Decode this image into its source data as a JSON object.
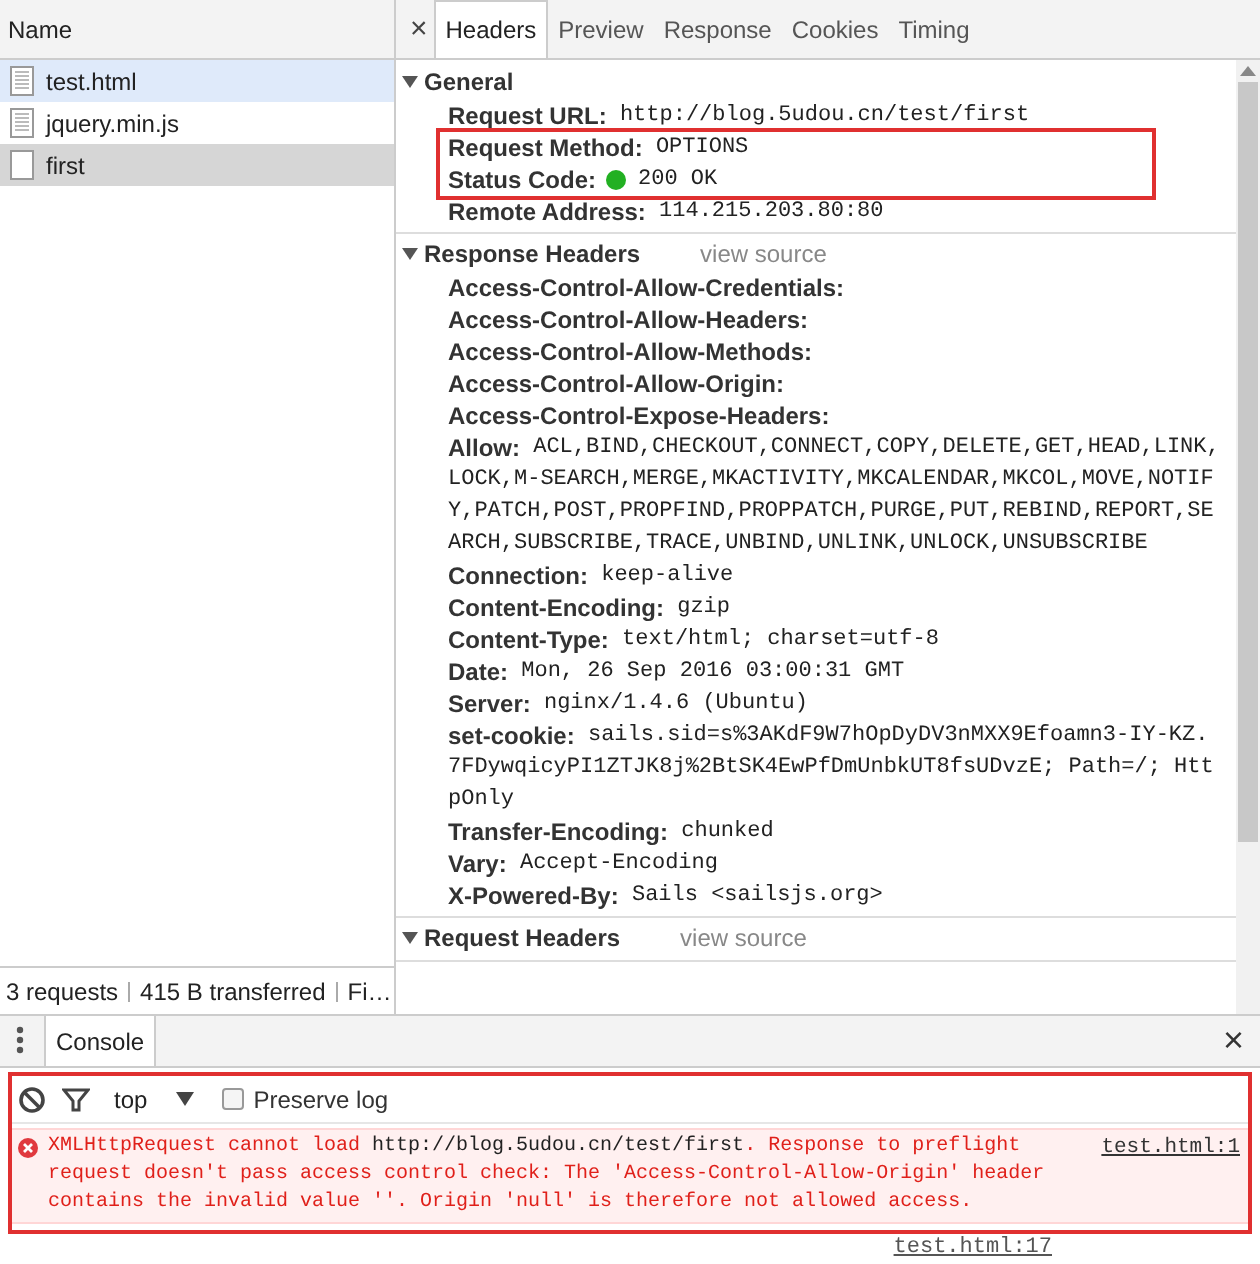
{
  "requests": {
    "column": "Name",
    "items": [
      {
        "name": "test.html",
        "kind": "document",
        "selected": false,
        "hovered": true
      },
      {
        "name": "jquery.min.js",
        "kind": "document",
        "selected": false,
        "hovered": false
      },
      {
        "name": "first",
        "kind": "blank",
        "selected": true,
        "hovered": false
      }
    ],
    "status": [
      "3 requests",
      "415 B transferred",
      "Fi…"
    ]
  },
  "details": {
    "close": "×",
    "tabs": [
      {
        "label": "Headers",
        "selected": true
      },
      {
        "label": "Preview",
        "selected": false
      },
      {
        "label": "Response",
        "selected": false
      },
      {
        "label": "Cookies",
        "selected": false
      },
      {
        "label": "Timing",
        "selected": false
      }
    ],
    "sections": [
      {
        "title": "General",
        "expanded": true,
        "headers": [
          {
            "name": "Request URL:",
            "value": "http://blog.5udou.cn/test/first",
            "highlighted": false
          },
          {
            "name": "Request Method:",
            "value": "OPTIONS",
            "highlighted": true
          },
          {
            "name": "Status Code:",
            "value": "200 OK",
            "kind": "status",
            "highlighted": true
          },
          {
            "name": "Remote Address:",
            "value": "114.215.203.80:80",
            "highlighted": false
          }
        ]
      },
      {
        "title": "Response Headers",
        "link": "view source",
        "expanded": true,
        "headers": [
          {
            "name": "Access-Control-Allow-Credentials:",
            "highlighted": false
          },
          {
            "name": "Access-Control-Allow-Headers:",
            "highlighted": false
          },
          {
            "name": "Access-Control-Allow-Methods:",
            "highlighted": false
          },
          {
            "name": "Access-Control-Allow-Origin:",
            "highlighted": false
          },
          {
            "name": "Access-Control-Expose-Headers:",
            "highlighted": false
          },
          {
            "name": "Allow:",
            "value": "ACL,BIND,CHECKOUT,CONNECT,COPY,DELETE,GET,HEAD,LINK,LOCK,M-SEARCH,MERGE,MKACTIVITY,MKCALENDAR,MKCOL,MOVE,NOTIFY,PATCH,POST,PROPFIND,PROPPATCH,PURGE,PUT,REBIND,REPORT,SEARCH,SUBSCRIBE,TRACE,UNBIND,UNLINK,UNLOCK,UNSUBSCRIBE",
            "highlighted": false
          },
          {
            "name": "Connection:",
            "value": "keep-alive",
            "highlighted": false
          },
          {
            "name": "Content-Encoding:",
            "value": "gzip",
            "highlighted": false
          },
          {
            "name": "Content-Type:",
            "value": "text/html; charset=utf-8",
            "highlighted": false
          },
          {
            "name": "Date:",
            "value": "Mon, 26 Sep 2016 03:00:31 GMT",
            "highlighted": false
          },
          {
            "name": "Server:",
            "value": "nginx/1.4.6 (Ubuntu)",
            "highlighted": false
          },
          {
            "name": "set-cookie:",
            "value": "sails.sid=s%3AKdF9W7hOpDyDV3nMXX9Efoamn3-IY-KZ.7FDywqicyPI1ZTJK8j%2BtSK4EwPfDmUnbkUT8fsUDvzE; Path=/; HttpOnly",
            "highlighted": false
          },
          {
            "name": "Transfer-Encoding:",
            "value": "chunked",
            "highlighted": false
          },
          {
            "name": "Vary:",
            "value": "Accept-Encoding",
            "highlighted": false
          },
          {
            "name": "X-Powered-By:",
            "value": "Sails <sailsjs.org>",
            "highlighted": false
          }
        ]
      },
      {
        "title": "Request Headers",
        "link": "view source",
        "expanded": true
      }
    ]
  },
  "drawer": {
    "tabs": [
      {
        "label": "Console",
        "selected": true
      }
    ],
    "close": "×",
    "toolbar": {
      "context": "top",
      "preserve_log": {
        "label": "Preserve log",
        "checked": false
      }
    },
    "messages": [
      {
        "kind": "error",
        "parts": [
          {
            "text": "XMLHttpRequest cannot load ",
            "kind": "plain"
          },
          {
            "text": "http://blog.5udou.cn/test/first",
            "kind": "url"
          },
          {
            "text": ". Response to preflight request doesn't pass access control check: The 'Access-Control-Allow-Origin' header contains the invalid value ''. Origin 'null' is therefore not allowed access.",
            "kind": "plain"
          }
        ],
        "source": "test.html:1"
      },
      {
        "kind": "log",
        "source": "test.html:17"
      }
    ]
  }
}
